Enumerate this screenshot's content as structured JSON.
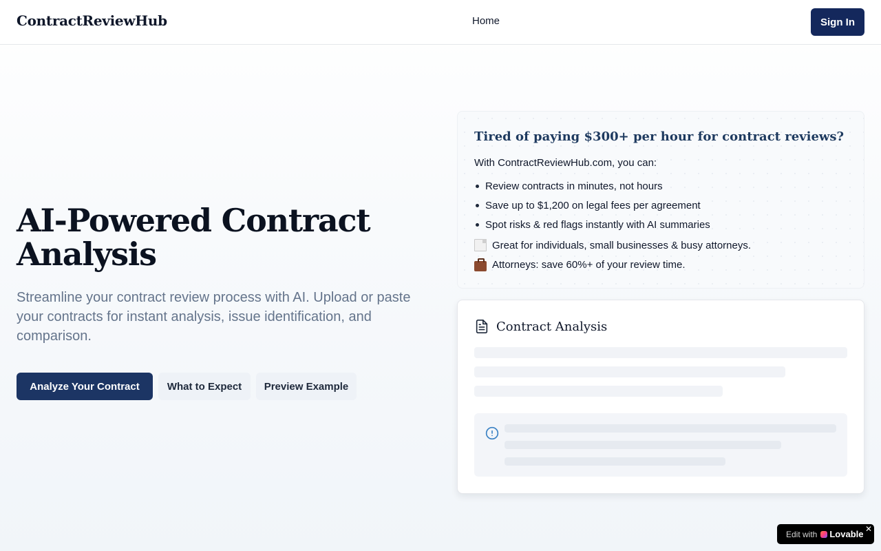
{
  "navbar": {
    "brand": "ContractReviewHub",
    "links": [
      {
        "label": "Home"
      }
    ],
    "signin_label": "Sign In"
  },
  "hero": {
    "title": "AI-Powered Contract Analysis",
    "subtitle": "Streamline your contract review process with AI. Upload or paste your contracts for instant analysis, issue identification, and comparison.",
    "buttons": {
      "primary": "Analyze Your Contract",
      "expect": "What to Expect",
      "preview": "Preview Example"
    }
  },
  "pitch_card": {
    "title": "Tired of paying $300+ per hour for contract reviews?",
    "intro": "With ContractReviewHub.com, you can:",
    "bullets": [
      "Review contracts in minutes, not hours",
      "Save up to $1,200 on legal fees per agreement",
      "Spot risks & red flags instantly with AI summaries"
    ],
    "extras": [
      {
        "icon": "document-icon",
        "text": "Great for individuals, small businesses & busy attorneys."
      },
      {
        "icon": "briefcase-icon",
        "text": "Attorneys: save 60%+ of your review time."
      }
    ]
  },
  "analysis_card": {
    "title": "Contract Analysis",
    "icon": "file-text-icon",
    "alert_icon": "alert-circle-icon"
  },
  "lovable_badge": {
    "edit_label": "Edit with",
    "brand": "Lovable",
    "close": "✕"
  },
  "colors": {
    "primary": "#1c3564",
    "signin": "#14285c",
    "pitch_title": "#1e3a5f",
    "subtitle": "#64748b",
    "alert_icon": "#3b82c4"
  }
}
